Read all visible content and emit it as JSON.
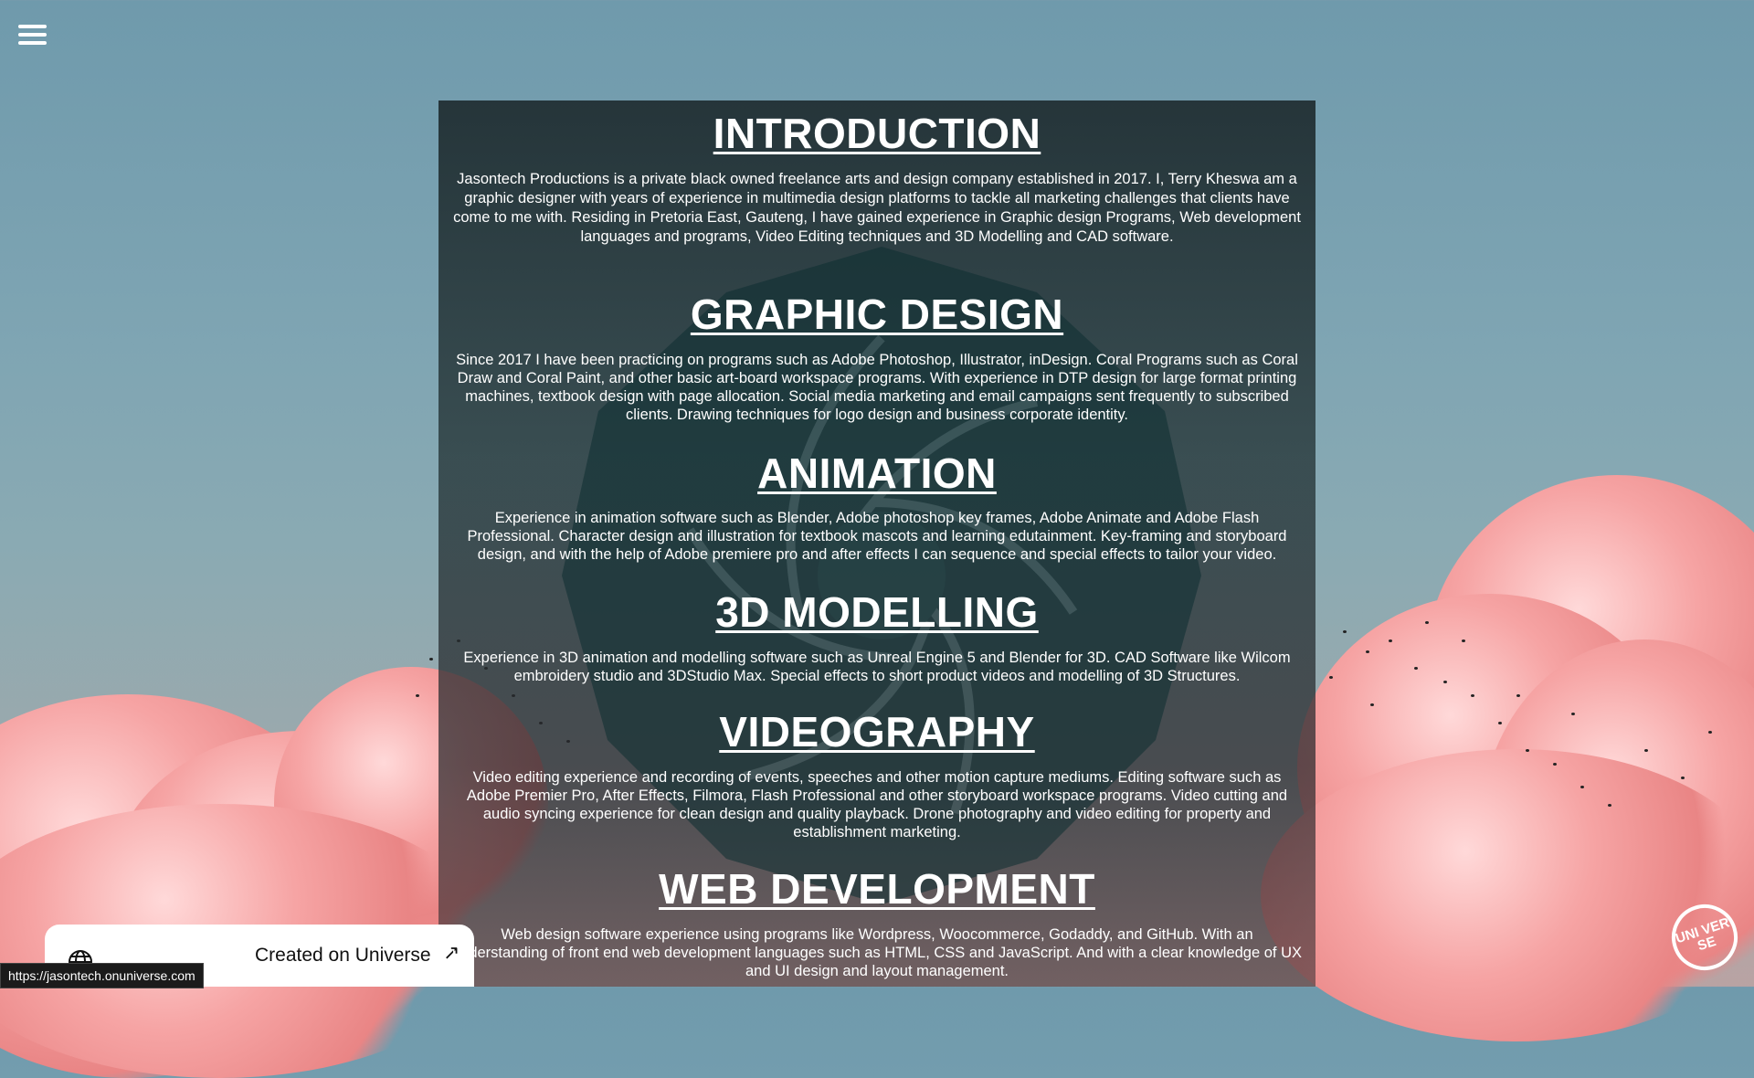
{
  "menu": {
    "icon": "hamburger-menu-icon"
  },
  "sections": [
    {
      "heading": "INTRODUCTION",
      "body": "Jasontech Productions is a private black owned freelance arts and design company established in 2017. I, Terry Kheswa am a graphic designer with years of experience in multimedia design platforms to tackle all marketing challenges that clients have come to me with. Residing in Pretoria East, Gauteng, I have gained experience in Graphic design Programs, Web development languages and programs, Video Editing techniques and 3D Modelling and CAD software."
    },
    {
      "heading": "GRAPHIC DESIGN ",
      "body": "Since 2017 I have been practicing on programs such as Adobe Photoshop, Illustrator, inDesign. Coral Programs such as Coral Draw and Coral Paint, and other basic art-board workspace programs. With experience in DTP design for large format printing machines, textbook design with page allocation. Social media marketing and email campaigns sent frequently to subscribed clients. Drawing techniques for logo design and business corporate identity."
    },
    {
      "heading": "ANIMATION",
      "body": "Experience in animation software such as Blender, Adobe photoshop key frames, Adobe Animate and Adobe Flash Professional. Character design and illustration for textbook mascots and learning edutainment. Key-framing and storyboard design, and with the help of Adobe premiere pro and after effects I can sequence and special effects to tailor your video."
    },
    {
      "heading": "3D MODELLING",
      "body": "Experience in 3D animation and modelling software such as Unreal Engine 5 and Blender for 3D. CAD Software like Wilcom embroidery studio and 3DStudio Max. Special effects to short product videos and modelling of 3D Structures."
    },
    {
      "heading": "VIDEOGRAPHY ",
      "body": "Video editing experience and recording of events, speeches and other motion capture mediums. Editing software such as Adobe Premier Pro, After Effects, Filmora, Flash Professional and other storyboard workspace programs. Video cutting and audio syncing experience for clean design and quality playback. Drone photography and video editing for property and establishment marketing."
    },
    {
      "heading": "WEB DEVELOPMENT",
      "body": "Web design software experience using programs like Wordpress, Woocommerce, Godaddy, and GitHub. With an understanding of front end web development languages such as HTML, CSS and JavaScript. And with a clear knowledge of UX and UI design and layout management."
    }
  ],
  "badge": {
    "label": "Created on Universe",
    "icon": "globe-icon",
    "arrow_icon": "external-arrow-icon"
  },
  "status_url": "https://jasontech.onuniverse.com",
  "logo": {
    "text": "UNI VER SE"
  },
  "colors": {
    "sky": "#7fa5b3",
    "cloud": "#f39a9a",
    "panel": "#1e2b2d"
  }
}
